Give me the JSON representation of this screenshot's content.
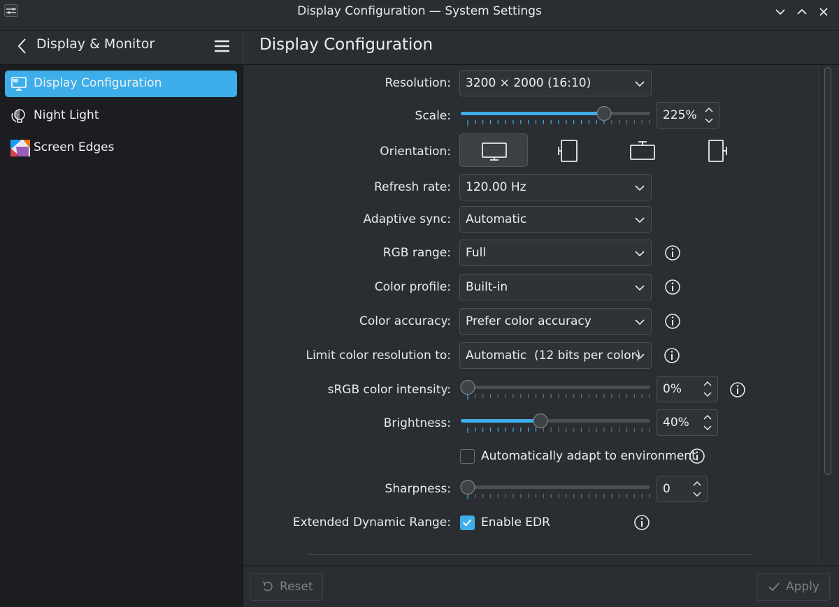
{
  "window": {
    "title": "Display Configuration — System Settings"
  },
  "sidebar": {
    "heading": "Display & Monitor",
    "items": [
      {
        "label": "Display Configuration",
        "icon": "monitor-icon",
        "active": true
      },
      {
        "label": "Night Light",
        "icon": "night-light-icon",
        "active": false
      },
      {
        "label": "Screen Edges",
        "icon": "screen-edges-icon",
        "active": false
      }
    ]
  },
  "main": {
    "title": "Display Configuration",
    "resolution": {
      "label": "Resolution:",
      "value": "3200 × 2000 (16:10)"
    },
    "scale": {
      "label": "Scale:",
      "value": "225%",
      "level": 0.75
    },
    "orientation": {
      "label": "Orientation:",
      "selected": "landscape",
      "options": [
        "landscape",
        "portrait-left",
        "landscape-flipped",
        "portrait-right"
      ]
    },
    "refresh_rate": {
      "label": "Refresh rate:",
      "value": "120.00 Hz"
    },
    "adaptive_sync": {
      "label": "Adaptive sync:",
      "value": "Automatic"
    },
    "rgb_range": {
      "label": "RGB range:",
      "value": "Full"
    },
    "color_profile": {
      "label": "Color profile:",
      "value": "Built-in"
    },
    "color_accuracy": {
      "label": "Color accuracy:",
      "value": "Prefer color accuracy"
    },
    "color_resolution": {
      "label": "Limit color resolution to:",
      "value": "Automatic  (12 bits per color)"
    },
    "srgb_intensity": {
      "label": "sRGB color intensity:",
      "value": "0%",
      "level": 0
    },
    "brightness": {
      "label": "Brightness:",
      "value": "40%",
      "level": 0.4
    },
    "auto_adapt": {
      "label": "Automatically adapt to environment",
      "checked": false
    },
    "sharpness": {
      "label": "Sharpness:",
      "value": "0",
      "level": 0
    },
    "edr": {
      "label": "Extended Dynamic Range:",
      "checkbox_label": "Enable EDR",
      "checked": true
    }
  },
  "footer": {
    "reset_label": "Reset",
    "apply_label": "Apply"
  },
  "colors": {
    "accent": "#3daee9",
    "background": "#2a2e32",
    "sidebar": "#1b1d20"
  }
}
